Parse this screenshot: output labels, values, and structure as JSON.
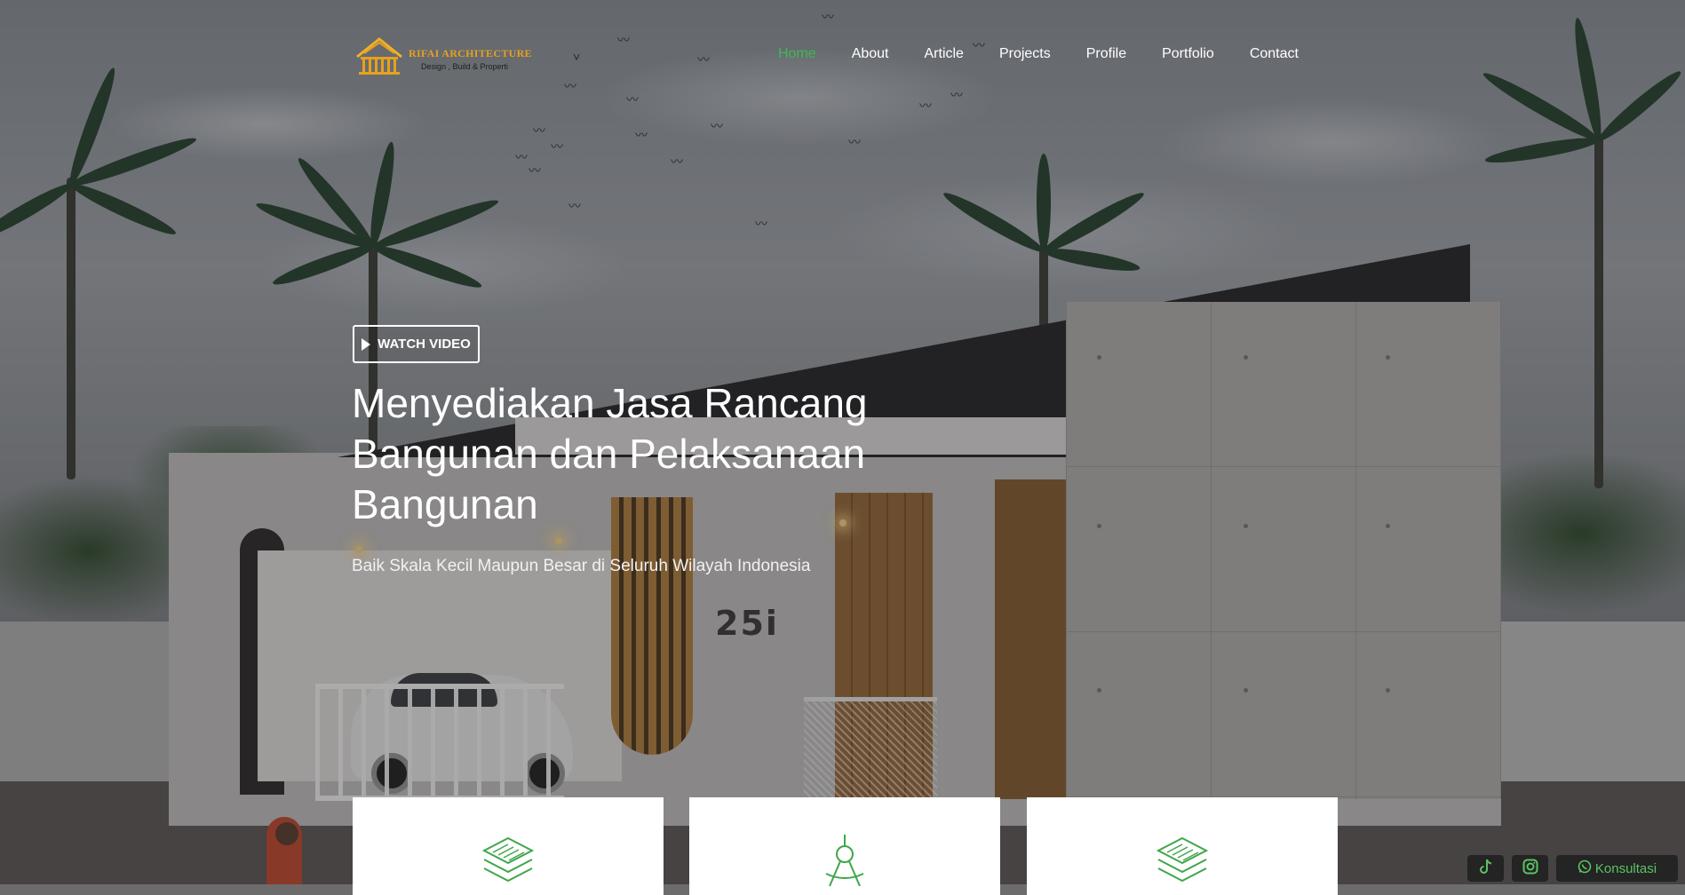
{
  "logo": {
    "brand": "RIFAI ARCHITECTURE",
    "tagline": "Design , Build & Properti"
  },
  "nav": {
    "items": [
      {
        "label": "Home",
        "active": true
      },
      {
        "label": "About",
        "active": false
      },
      {
        "label": "Article",
        "active": false
      },
      {
        "label": "Projects",
        "active": false
      },
      {
        "label": "Profile",
        "active": false
      },
      {
        "label": "Portfolio",
        "active": false
      },
      {
        "label": "Contact",
        "active": false
      }
    ]
  },
  "hero": {
    "watch_video_label": "WATCH VIDEO",
    "headline": "Menyediakan Jasa Rancang Bangunan dan Pelaksanaan Bangunan",
    "subheadline": "Baik Skala Kecil Maupun Besar di Seluruh Wilayah Indonesia",
    "house_number": "25i"
  },
  "cards": [
    {
      "icon": "layers-icon"
    },
    {
      "icon": "compass-drafting-icon"
    },
    {
      "icon": "layers-icon"
    }
  ],
  "social": {
    "tiktok_icon": "tiktok-icon",
    "instagram_icon": "instagram-icon",
    "whatsapp_icon": "whatsapp-icon",
    "whatsapp_label": "Konsultasi"
  },
  "colors": {
    "accent_green": "#3fb950",
    "logo_gold": "#e6a11c",
    "social_bar_bg": "#242424"
  }
}
